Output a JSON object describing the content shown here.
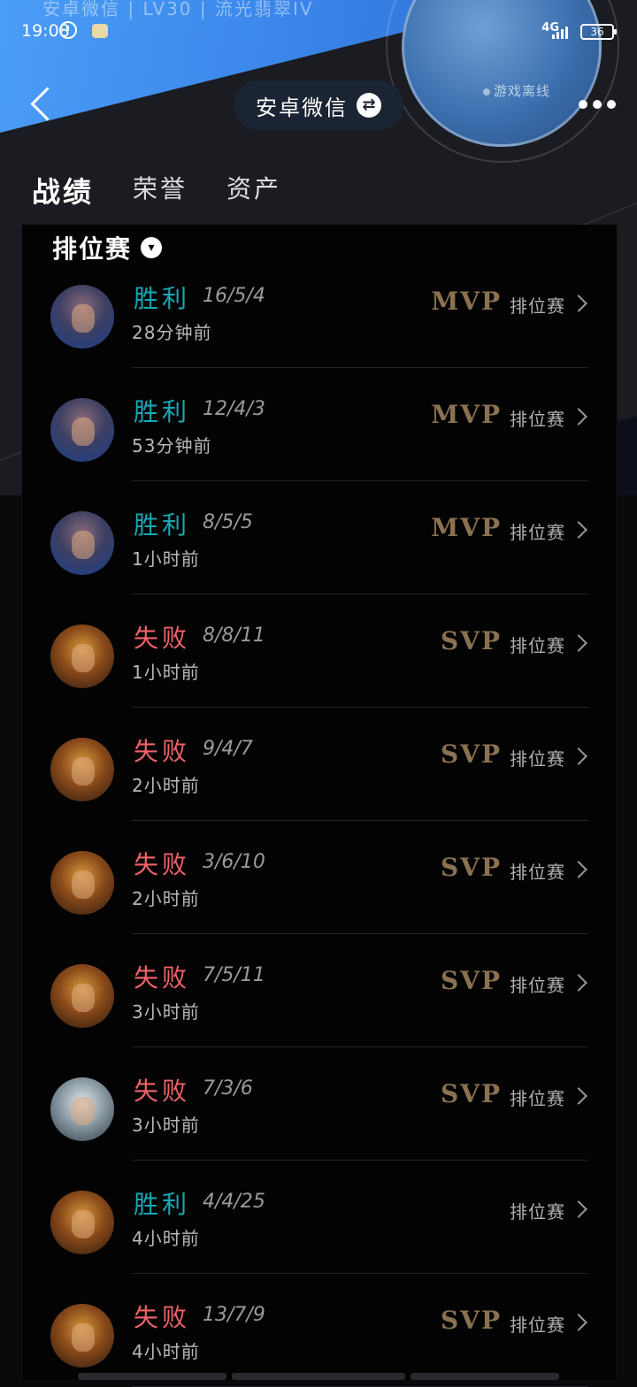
{
  "banner": {
    "ghost_text": "安卓微信 | LV30 | 流光翡翠IV",
    "offline_status": "游戏离线"
  },
  "status_bar": {
    "time": "19:08",
    "network": "4G",
    "battery": "36"
  },
  "nav": {
    "account_label": "安卓微信",
    "swap_icon": "⇄"
  },
  "tabs": [
    {
      "label": "战绩",
      "active": true
    },
    {
      "label": "荣誉",
      "active": false
    },
    {
      "label": "资产",
      "active": false
    }
  ],
  "filter": {
    "label": "排位赛",
    "chevron": "▾"
  },
  "matches": [
    {
      "result": "胜利",
      "outcome": "win",
      "kda": "16/5/4",
      "time": "28分钟前",
      "badge": "MVP",
      "mode": "排位赛",
      "hero": "blue"
    },
    {
      "result": "胜利",
      "outcome": "win",
      "kda": "12/4/3",
      "time": "53分钟前",
      "badge": "MVP",
      "mode": "排位赛",
      "hero": "blue"
    },
    {
      "result": "胜利",
      "outcome": "win",
      "kda": "8/5/5",
      "time": "1小时前",
      "badge": "MVP",
      "mode": "排位赛",
      "hero": "blue"
    },
    {
      "result": "失败",
      "outcome": "loss",
      "kda": "8/8/11",
      "time": "1小时前",
      "badge": "SVP",
      "mode": "排位赛",
      "hero": "gold"
    },
    {
      "result": "失败",
      "outcome": "loss",
      "kda": "9/4/7",
      "time": "2小时前",
      "badge": "SVP",
      "mode": "排位赛",
      "hero": "gold"
    },
    {
      "result": "失败",
      "outcome": "loss",
      "kda": "3/6/10",
      "time": "2小时前",
      "badge": "SVP",
      "mode": "排位赛",
      "hero": "gold"
    },
    {
      "result": "失败",
      "outcome": "loss",
      "kda": "7/5/11",
      "time": "3小时前",
      "badge": "SVP",
      "mode": "排位赛",
      "hero": "gold"
    },
    {
      "result": "失败",
      "outcome": "loss",
      "kda": "7/3/6",
      "time": "3小时前",
      "badge": "SVP",
      "mode": "排位赛",
      "hero": "silver"
    },
    {
      "result": "胜利",
      "outcome": "win",
      "kda": "4/4/25",
      "time": "4小时前",
      "badge": "",
      "mode": "排位赛",
      "hero": "gold"
    },
    {
      "result": "失败",
      "outcome": "loss",
      "kda": "13/7/9",
      "time": "4小时前",
      "badge": "SVP",
      "mode": "排位赛",
      "hero": "gold"
    }
  ],
  "colors": {
    "win": "#17a8b4",
    "loss": "#f0626a",
    "badge": "#8a7250",
    "panel": "#030303"
  }
}
